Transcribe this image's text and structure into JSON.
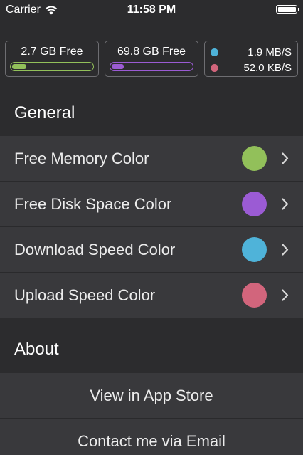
{
  "status_bar": {
    "carrier": "Carrier",
    "time": "11:58 PM",
    "wifi_icon": "wifi-icon",
    "battery_icon": "battery-icon"
  },
  "widgets": {
    "memory": {
      "label": "2.7 GB Free",
      "fill_fraction": 0.18,
      "color": "#92c05a"
    },
    "disk": {
      "label": "69.8 GB Free",
      "fill_fraction": 0.15,
      "color": "#9b5bd4"
    },
    "speed": {
      "download": "1.9 MB/S",
      "upload": "52.0 KB/S",
      "download_color": "#4fb3d9",
      "upload_color": "#d2657c"
    }
  },
  "general": {
    "header": "General",
    "items": [
      {
        "label": "Free Memory Color",
        "color": "#92c05a"
      },
      {
        "label": "Free Disk Space Color",
        "color": "#9b5bd4"
      },
      {
        "label": "Download Speed Color",
        "color": "#4fb3d9"
      },
      {
        "label": "Upload Speed Color",
        "color": "#d2657c"
      }
    ]
  },
  "about": {
    "header": "About",
    "items": [
      {
        "label": "View in App Store"
      },
      {
        "label": "Contact me via Email"
      }
    ]
  }
}
